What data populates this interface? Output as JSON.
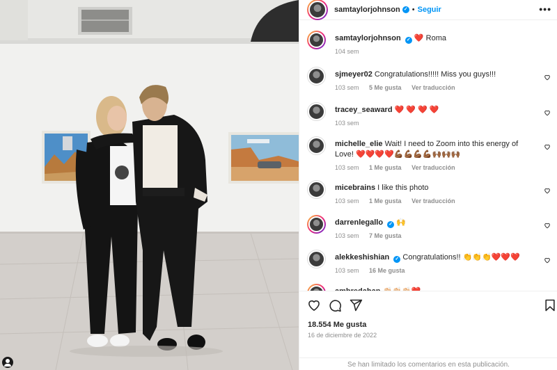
{
  "post": {
    "author": "samtaylorjohnson",
    "follow_label": "Seguir",
    "dot": "•",
    "more_label": "•••",
    "caption": {
      "user": "samtaylorjohnson",
      "text": "❤️ Roma",
      "time": "104 sem"
    }
  },
  "comments": [
    {
      "user": "sjmeyer02",
      "text": "Congratulations!!!!! Miss you guys!!!",
      "time": "103 sem",
      "likes": "5 Me gusta",
      "translate": "Ver traducción"
    },
    {
      "user": "tracey_seaward",
      "text": "❤️ ❤️ ❤️ ❤️",
      "time": "103 sem",
      "likes": "",
      "translate": ""
    },
    {
      "user": "michelle_elie",
      "text": "Wait! I need to Zoom into this energy of Love! ❤️❤️❤️❤️💪🏾💪🏾💪🏾💪🏾🙌🏾🙌🏾🙌🏾",
      "time": "103 sem",
      "likes": "1 Me gusta",
      "translate": "Ver traducción"
    },
    {
      "user": "micebrains",
      "text": "I like this photo",
      "time": "103 sem",
      "likes": "1 Me gusta",
      "translate": "Ver traducción"
    },
    {
      "user": "darrenlegallo",
      "text": "🙌",
      "time": "103 sem",
      "likes": "7 Me gusta",
      "translate": ""
    },
    {
      "user": "alekkeshishian",
      "text": "Congratulations!! 👏👏👏❤️❤️❤️",
      "time": "103 sem",
      "likes": "16 Me gusta",
      "translate": ""
    },
    {
      "user": "ambredahan",
      "text": "👏🏻👏🏻👏🏻❤️",
      "time": "",
      "likes": "",
      "translate": ""
    }
  ],
  "footer": {
    "likes": "18.554 Me gusta",
    "date": "16 de diciembre de 2022",
    "limited": "Se han limitado los comentarios en esta publicación."
  },
  "icons": {
    "like": "heart-icon",
    "comment": "comment-icon",
    "share": "share-icon",
    "save": "bookmark-icon",
    "verified": "verified-badge-icon"
  },
  "colors": {
    "accent": "#0095f6",
    "heart": "#ed4956",
    "muted": "#8e8e8e"
  }
}
